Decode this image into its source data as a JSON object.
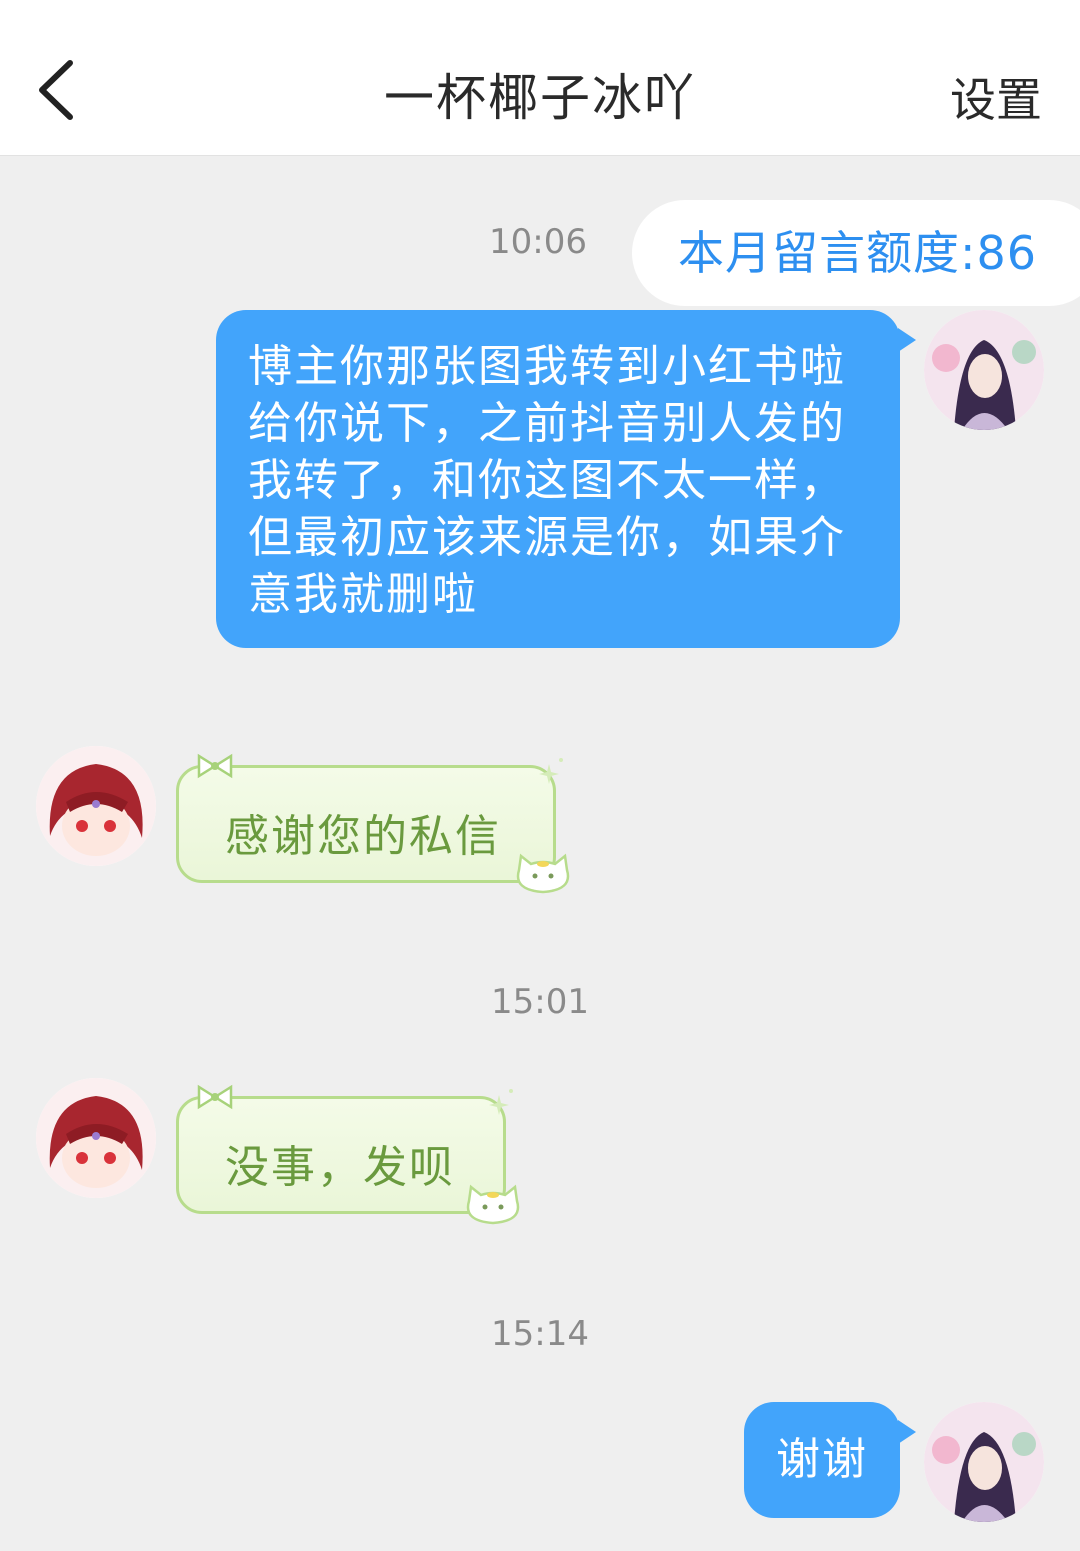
{
  "header": {
    "back_icon": "chevron-left-icon",
    "title": "一杯椰子冰吖",
    "settings_label": "设置"
  },
  "chat": {
    "quota_label": "本月留言额度:86",
    "messages": [
      {
        "time": "10:06"
      },
      {
        "sender": "me",
        "lines": [
          "博主你那张图我转到小红书啦",
          "给你说下，之前抖音别人发的",
          "我转了，和你这图不太一样，",
          "但最初应该来源是你，如果介",
          "意我就删啦"
        ]
      },
      {
        "sender": "them",
        "text": "感谢您的私信"
      },
      {
        "time": "15:01"
      },
      {
        "sender": "them",
        "text": "没事，发呗"
      },
      {
        "time": "15:14"
      },
      {
        "sender": "me",
        "text": "谢谢"
      }
    ]
  },
  "colors": {
    "accent": "#42a4fb",
    "quota_text": "#2d8ff0",
    "them_bubble_border": "#b7dc8c",
    "them_text": "#6a9a3e",
    "background": "#efefef"
  }
}
